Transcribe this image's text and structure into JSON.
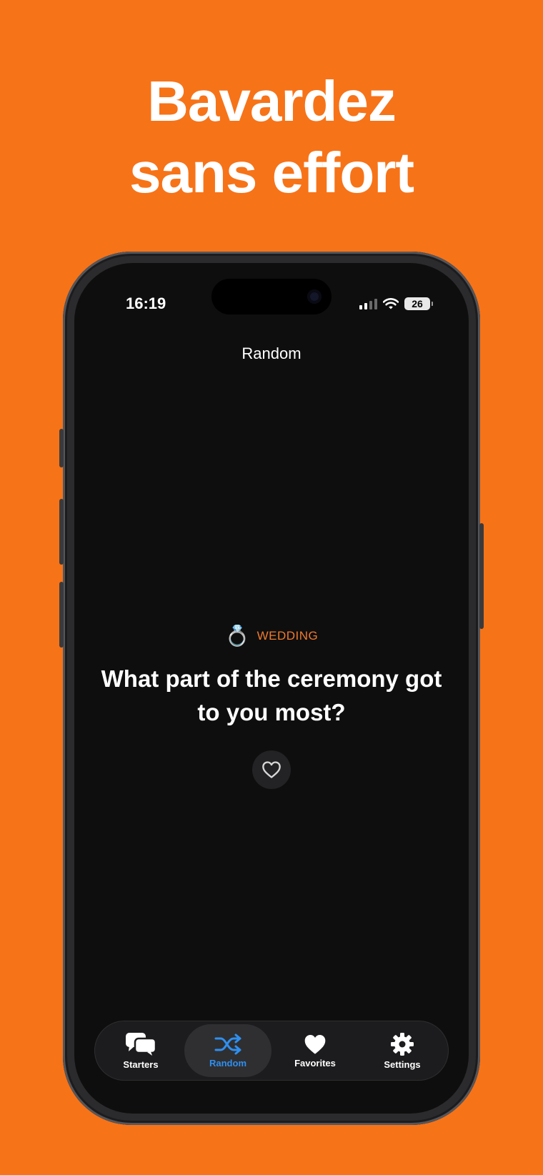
{
  "headline": {
    "line1": "Bavardez",
    "line2": "sans effort"
  },
  "status_bar": {
    "time": "16:19",
    "battery": "26",
    "icons": [
      "signal-icon",
      "wifi-icon",
      "battery-icon"
    ]
  },
  "nav": {
    "title": "Random"
  },
  "card": {
    "category_emoji": "💍",
    "category": "WEDDING",
    "question": "What part of the ceremony got to you most?",
    "favorite_icon": "heart-outline-icon"
  },
  "tabs": [
    {
      "label": "Starters",
      "icon": "chat-bubbles-icon",
      "active": false
    },
    {
      "label": "Random",
      "icon": "shuffle-icon",
      "active": true
    },
    {
      "label": "Favorites",
      "icon": "heart-icon",
      "active": false
    },
    {
      "label": "Settings",
      "icon": "gear-icon",
      "active": false
    }
  ],
  "colors": {
    "background": "#F77318",
    "screen": "#0E0E0E",
    "category_accent": "#EF7A2C",
    "tab_active": "#2F8FF0"
  }
}
